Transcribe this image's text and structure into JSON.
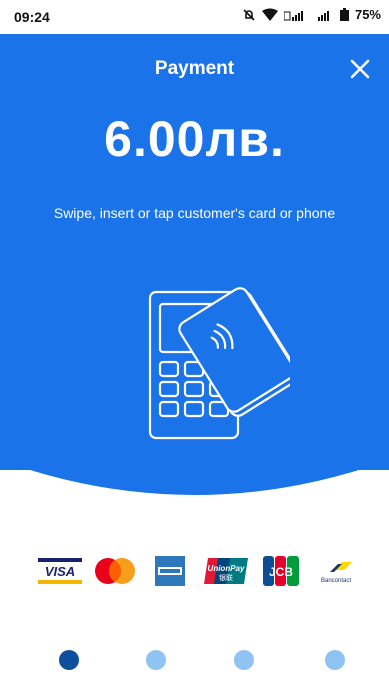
{
  "status": {
    "time": "09:24",
    "battery": "75%"
  },
  "header": {
    "title": "Payment"
  },
  "payment": {
    "amount": "6.00лв.",
    "instruction": "Swipe, insert or tap customer's card or phone"
  },
  "card_brands": {
    "visa": "VISA",
    "unionpay_label": "UnionPay",
    "unionpay_sub": "银联",
    "jcb": "JCB",
    "bancontact": "Bancontact"
  },
  "pager": {
    "active_index": 0,
    "count": 4
  },
  "colors": {
    "primary": "#1a73e8",
    "dot_active": "#0d4f9c",
    "dot_inactive": "#8fc3f2"
  }
}
